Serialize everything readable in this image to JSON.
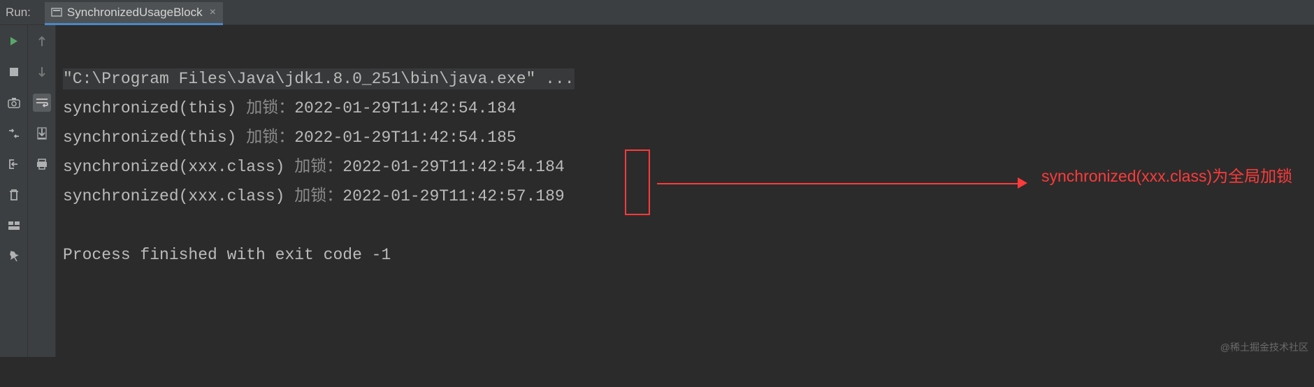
{
  "header": {
    "run_label": "Run:",
    "tab_name": "SynchronizedUsageBlock",
    "close_glyph": "×"
  },
  "console": {
    "command": "\"C:\\Program Files\\Java\\jdk1.8.0_251\\bin\\java.exe\" ...",
    "lines": [
      {
        "prefix": "synchronized(this) ",
        "cn": "加锁：",
        "time": "2022-01-29T11:42:54.184"
      },
      {
        "prefix": "synchronized(this) ",
        "cn": "加锁：",
        "time": "2022-01-29T11:42:54.185"
      },
      {
        "prefix": "synchronized(xxx.class) ",
        "cn": "加锁：",
        "time": "2022-01-29T11:42:54.184"
      },
      {
        "prefix": "synchronized(xxx.class) ",
        "cn": "加锁：",
        "time": "2022-01-29T11:42:57.189"
      }
    ],
    "exit_line": "Process finished with exit code -1"
  },
  "annotation": {
    "text": "synchronized(xxx.class)为全局加锁"
  },
  "watermark": "@稀土掘金技术社区",
  "icons": {
    "run": "▶",
    "up": "↑",
    "stop": "■",
    "down": "↓",
    "camera": "◉",
    "wrap": "↩",
    "fragments": "⇄",
    "scroll_end": "⤓",
    "exit": "⇤",
    "print": "⎙",
    "trash": "🗑",
    "layout": "▭",
    "pin": "📌"
  }
}
